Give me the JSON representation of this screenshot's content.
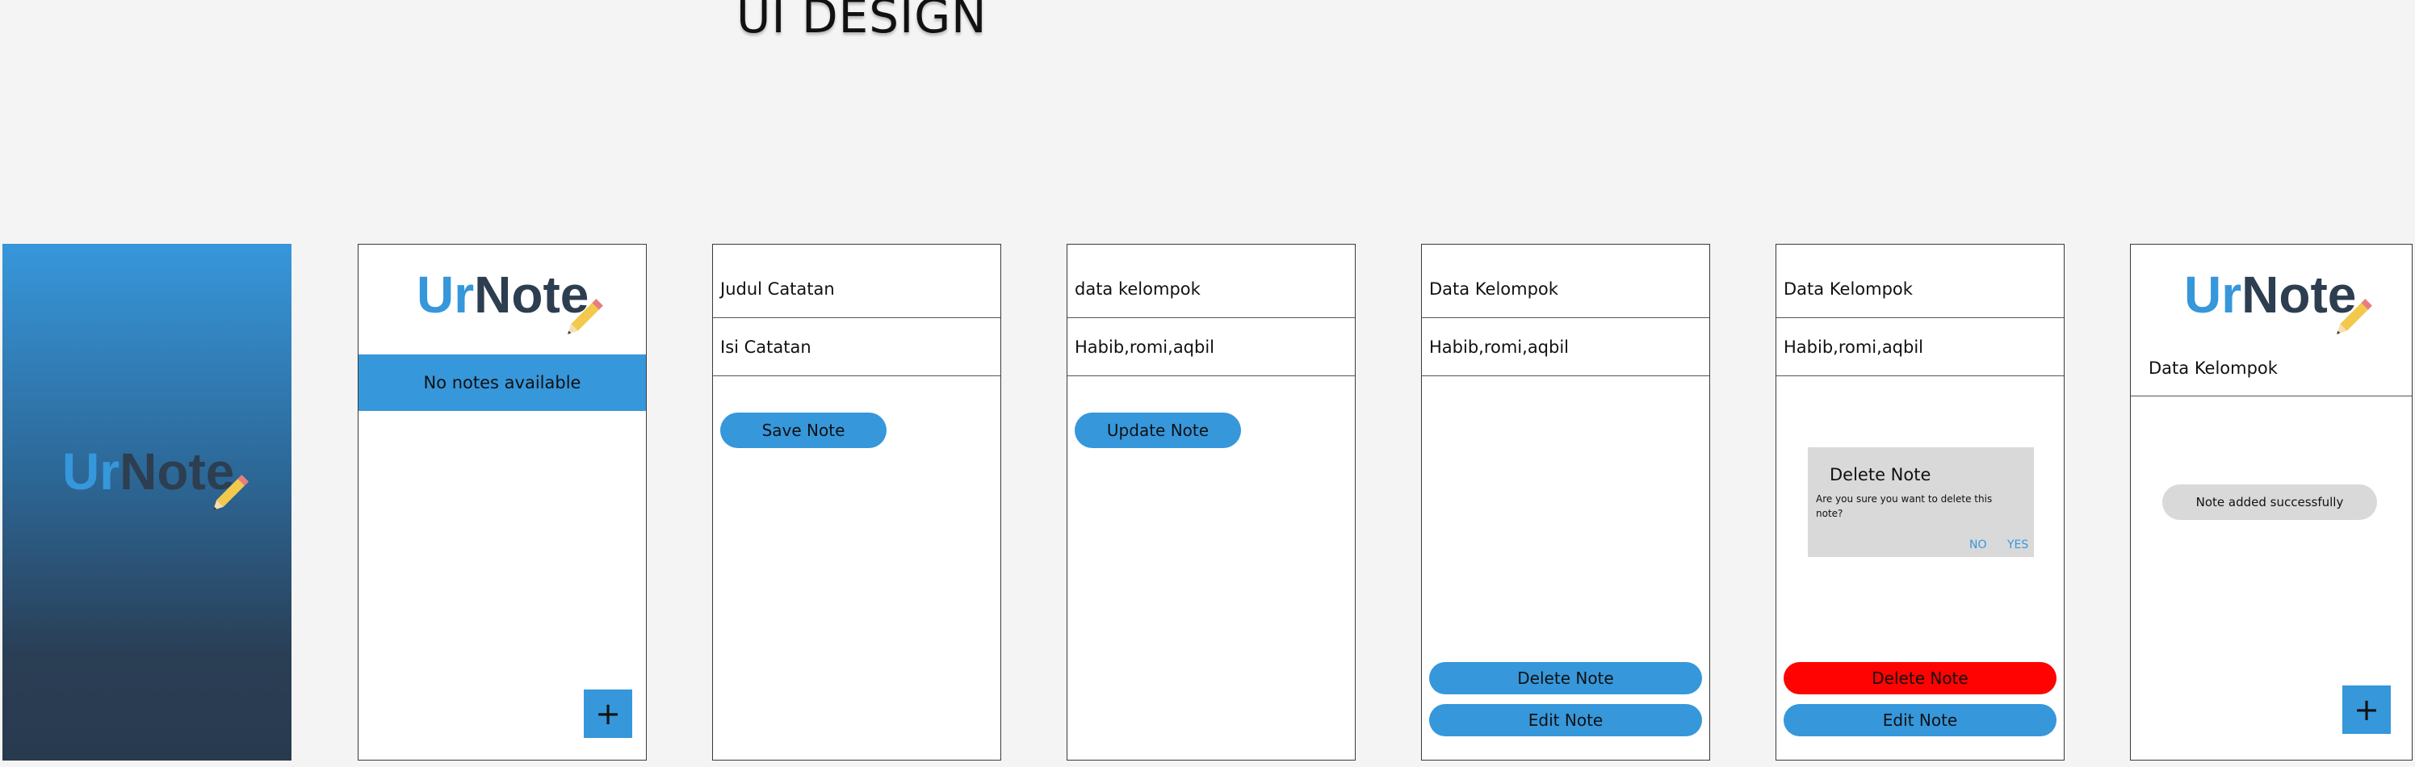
{
  "header": {
    "title": "UI DESIGN"
  },
  "brand": {
    "part1": "Ur",
    "part2": "Note",
    "accent_color": "#3697db",
    "dark_color": "#2c3e50"
  },
  "screens": {
    "splash": {
      "logo_part1": "Ur",
      "logo_part2": "Note"
    },
    "home": {
      "empty_message": "No notes available",
      "fab_label": "+"
    },
    "add": {
      "title_placeholder": "Judul Catatan",
      "body_placeholder": "Isi Catatan",
      "save_label": "Save Note"
    },
    "update": {
      "title_value": "data kelompok",
      "body_value": "Habib,romi,aqbil",
      "update_label": "Update Note"
    },
    "detail": {
      "title_value": "Data Kelompok",
      "body_value": "Habib,romi,aqbil",
      "delete_label": "Delete Note",
      "edit_label": "Edit Note"
    },
    "confirm": {
      "title_value": "Data Kelompok",
      "body_value": "Habib,romi,aqbil",
      "dialog_title": "Delete Note",
      "dialog_message": "Are you sure you want to delete this note?",
      "no_label": "NO",
      "yes_label": "YES",
      "delete_label": "Delete Note",
      "edit_label": "Edit Note"
    },
    "list": {
      "item_title": "Data Kelompok",
      "toast": "Note added successfully",
      "fab_label": "+"
    }
  },
  "colors": {
    "button_blue": "#3697db",
    "danger_red": "#ff0202",
    "dialog_grey": "#d9d9d9"
  }
}
